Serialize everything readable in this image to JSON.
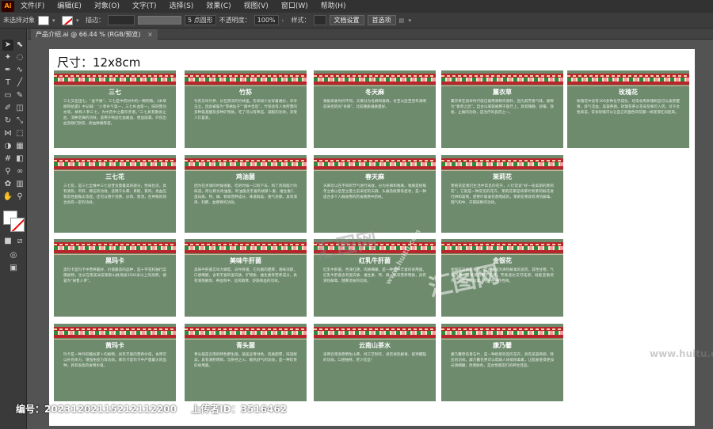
{
  "menubar": {
    "logo": "Ai",
    "items": [
      "文件(F)",
      "编辑(E)",
      "对象(O)",
      "文字(T)",
      "选择(S)",
      "效果(C)",
      "视图(V)",
      "窗口(W)",
      "帮助(H)"
    ]
  },
  "controlbar": {
    "selection_status": "未选择对象",
    "stroke_label": "描边：",
    "brush_value": "5 点圆形",
    "opacity_label": "不透明度：",
    "opacity_value": "100%",
    "style_label": "样式：",
    "doc_setup_button": "文档设置",
    "preferences_button": "首选项"
  },
  "document": {
    "tab_title": "产品介绍.ai @ 66.44 % (RGB/预览)",
    "close": "×"
  },
  "artboard": {
    "size_label": "尺寸：12x8cm"
  },
  "cards": [
    {
      "title": "三七",
      "body": "三七又名田七，“金不换”，三七是中药材中的一颗明珠。《本草纲目拾遗》中记载：“人参补气第一，三七补血第一，味同而功亦等，故称人参三七，为中药中之最珍贵者。”三七具有散瘀止血、消肿定痛的功效。适用于咯血吐血衄血、便血崩漏、外伤出血及跌打损伤、瘀血肿痛等症。"
    },
    {
      "title": "竹荪",
      "body": "竹荪又叫竹参，长在阴凉的竹林里。形状如少女穿着裙衫，亭亭玉立，因此被誉为“雪裙仙子”“菌中皇后”。竹荪含有人体所需的多种氨基酸及多种矿物质，吃了可以有降压、减脂的功效，深受人们喜爱。"
    },
    {
      "title": "冬天麻",
      "body": "根据采收时间不同，天麻分为冬麻和春麻，冬至以后至翌年清明前采挖的叫“冬麻”，比较重质满质量好。"
    },
    {
      "title": "薰衣草",
      "body": "薰衣草在很早时代就已被用来制作香料，因为其芳香气味，被称为“香草之后”。自古以来就被用于医疗上，具有镇静、舒缓、放松、止痛的功效，是治疗的良药之一。"
    },
    {
      "title": "玫瑰花",
      "body": "玫瑰花中含有300多种化学成份，经常食用玫瑰制品可以柔肝醒胃，舒气活血，美容养颜。玫瑰花茶以花朵及根可入药，对于女性来说，常食玫瑰可以让自己的面色同花瓣一样变得红润起来。"
    },
    {
      "title": "三七花",
      "body": "三七花，是三七全株中三七皂苷含量最高的部分，性味甘凉，具有清热、平肝、降压的功效。适用于头晕、目眩、耳鸣、高血压和急性咽喉炎等症。还可以用于泡茶、炒肉、煲汤，在导致的场合具有一定的功效。"
    },
    {
      "title": "鸡油菌",
      "body": "因为在烹调的时候很脆，吃的时候一口咬下去，和了鸡肉般汁的味道，所以称为鸡油菌。鸡油菌含丰富的胡萝卜素、维生素C、蛋白质、钙、磷、铁等营养成分，味道鲜美、香气浓郁，具有清目、利肺、益肠胃的功效。"
    },
    {
      "title": "春天麻",
      "body": "天麻可以在不同的节气进行采收，分为冬麻和春麻。春麻是指每年立春以后至立夏之前采挖的天麻，头痛及眩晕等症状，是一种适合多个人群食用的药食两用中药材。"
    },
    {
      "title": "茉莉花",
      "body": "茉莉花是我们生活中常见的花卉，人们常说“好一朵美丽的茉莉花”，它就是一种常见的花卉。茉莉花茶是将茶叶和茉莉鲜花进行拼和窨制，使茶叶吸收花香而成的，茉莉花茶具有清热解毒、理气和中、开郁辟秽的功效。"
    },
    {
      "title": "黑玛卡",
      "body": "黑玛卡是玛卡中营养最好、价值最高的品种，是十字花科独行菜属植物，生长在南美洲安第斯山脉海拔3500米以上的高原，被誉为“秘鲁人参”。"
    },
    {
      "title": "美味牛肝菌",
      "body": "美味牛肝菌又叫大脚菇、白牛肝菌，它的菌肉肥厚，香味浓郁，口感细腻，含有丰富的蛋白质、矿物质、维生素等营养成分，具有清热解烦、养血和中、追风散寒、舒筋和血的功效。"
    },
    {
      "title": "红乳牛肝菌",
      "body": "红乳牛肝菌，色泽红艳，肉质细嫩，是一种营养丰富的食用菌。红乳牛肝菌含有蛋白质、维生素、钙、磷、铁等营养物质，具有清热解毒、健脾消食的功效。"
    },
    {
      "title": "金银花",
      "body": "金银花又名忍冬花，自古被誉为清热解毒的良药。其性甘寒，气味芳香，甘寒清热而不伤胃，芳香透达又可祛邪，既能宣散风热，还善清解血毒，用于各种热性病。"
    },
    {
      "title": "黄玛卡",
      "body": "玛卡是一种外形酷似萝卜的植物，具有丰富的营养价值，食用可以补充体力、增强免疫力等功效。黄玛卡是玛卡中产量最大的品种，具有很高的食用价值。"
    },
    {
      "title": "青头菌",
      "body": "青头菌是云南的特色野生菌，菌盖呈青绿色，肉质肥厚，味道鲜美，具有清肝明目、泻肝经之火、散热舒气的功效，是一种珍贵的食用菌。"
    },
    {
      "title": "云南山茶水",
      "body": "采用云南高原野生山茶，经工艺制作，具有清热解毒、提神醒脑的功效，口感独特，老少皆宜！"
    },
    {
      "title": "康乃馨",
      "body": "康乃馨原名香石竹，是一种很受欢迎的花卉，具有美容养颜、降压的功效。康乃馨花茶可以帮助人体排除毒素，让肌肤变得更加光滑细嫩，改善肤色，是女性朋友们的养生佳品。"
    }
  ],
  "watermarks": [
    "汇图网",
    "www.huitu.com"
  ],
  "footer": {
    "id_label": "编号：20231202115212112200",
    "uploader_label": "上传者ID：3516462"
  },
  "colors": {
    "card_bg": "#6e8b6e",
    "band_red": "#b8252b",
    "artboard": "#ffffff",
    "workspace": "#535353"
  }
}
